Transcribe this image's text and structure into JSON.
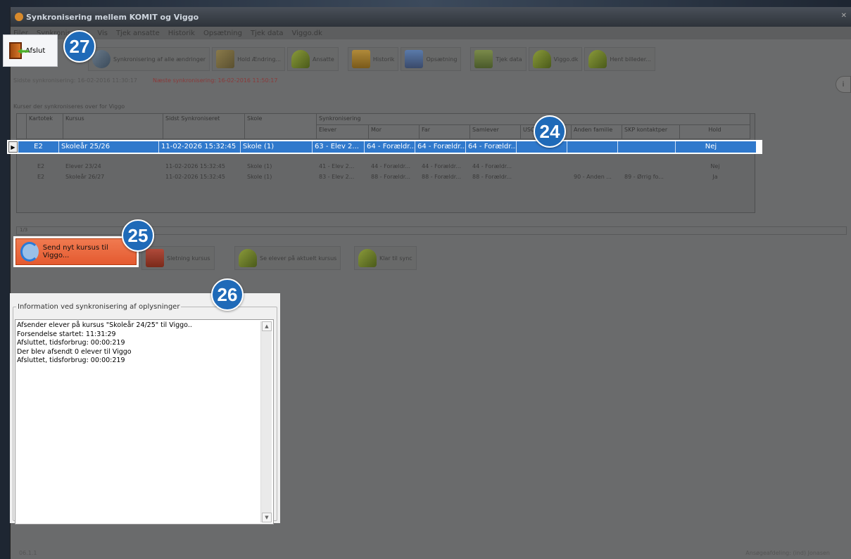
{
  "window": {
    "title": "Synkronisering mellem KOMIT og Viggo"
  },
  "menubar": [
    "Filer",
    "Synkronisering",
    "Vis",
    "Tjek ansatte",
    "Historik",
    "Opsætning",
    "Tjek data",
    "Viggo.dk"
  ],
  "toolbar": {
    "exit_label": "Afslut",
    "buttons": [
      "Synkronisering af alle ændringer",
      "Hold Ændring...",
      "Ansatte",
      "Historik",
      "Opsætning",
      "Tjek data",
      "Viggo.dk",
      "Hent billeder..."
    ]
  },
  "status": {
    "last_sync": "Sidste synkronisering: 16-02-2016 11:30:17",
    "next_sync": "Næste synkronisering: 16-02-2016 11:50:17"
  },
  "group_label": "Kurser der synkroniseres over for Viggo",
  "grid": {
    "headers": {
      "kartotek": "Kartotek",
      "kursus": "Kursus",
      "sidst": "Sidst Synkroniseret",
      "skole": "Skole",
      "synk": "Synkronisering",
      "elever": "Elever",
      "mor": "Mor",
      "far": "Far",
      "samlever": "Samlever",
      "uso": "USO",
      "anden_familie": "Anden familie",
      "skp": "SKP kontaktper",
      "hold": "Hold"
    },
    "rows": [
      {
        "kartotek": "E2",
        "kursus": "Skoleår 25/26",
        "sidst": "11-02-2026 15:32:45",
        "skole": "Skole (1)",
        "elever": "63 - Elev 2...",
        "mor": "64 - Forældr...",
        "far": "64 - Forældr...",
        "samlever": "64 - Forældr...",
        "uso": "",
        "anden_familie": "",
        "skp": "",
        "hold": "Nej"
      },
      {
        "kartotek": "E2",
        "kursus": "Elever 23/24",
        "sidst": "11-02-2026 15:32:45",
        "skole": "Skole (1)",
        "elever": "41 - Elev 2...",
        "mor": "44 - Forældr...",
        "far": "44 - Forældr...",
        "samlever": "44 - Forældr...",
        "uso": "",
        "anden_familie": "",
        "skp": "",
        "hold": "Nej"
      },
      {
        "kartotek": "E2",
        "kursus": "Skoleår 26/27",
        "sidst": "11-02-2026 15:32:45",
        "skole": "Skole (1)",
        "elever": "83 - Elev 2...",
        "mor": "88 - Forældr...",
        "far": "88 - Forældr...",
        "samlever": "88 - Forældr...",
        "uso": "",
        "anden_familie": "90 - Anden ...",
        "skp": "89 - Ørrig fo...",
        "hold": "Ja"
      }
    ],
    "count": "1/3"
  },
  "actions": {
    "send_label": "Send nyt kursus til Viggo...",
    "others": [
      "Sletning kursus",
      "Se elever på aktuelt kursus",
      "Klar til sync"
    ]
  },
  "info_panel": {
    "legend": "Information ved synkronisering af oplysninger",
    "lines": [
      "Afsender elever på kursus \"Skoleår 24/25\" til Viggo..",
      "Forsendelse startet: 11:31:29",
      "Afsluttet, tidsforbrug: 00:00:219",
      "Der blev afsendt 0 elever til Viggo",
      "Afsluttet, tidsforbrug: 00:00:219"
    ]
  },
  "bottom_status": {
    "left": "06.1.1",
    "right": "Ansøgeafdeling: (ind) Jonasen"
  },
  "badges": [
    "27",
    "24",
    "25",
    "26"
  ],
  "colors": {
    "selection": "#3079cc",
    "badge": "#1f6ab8",
    "send_button": "#e45a30"
  }
}
